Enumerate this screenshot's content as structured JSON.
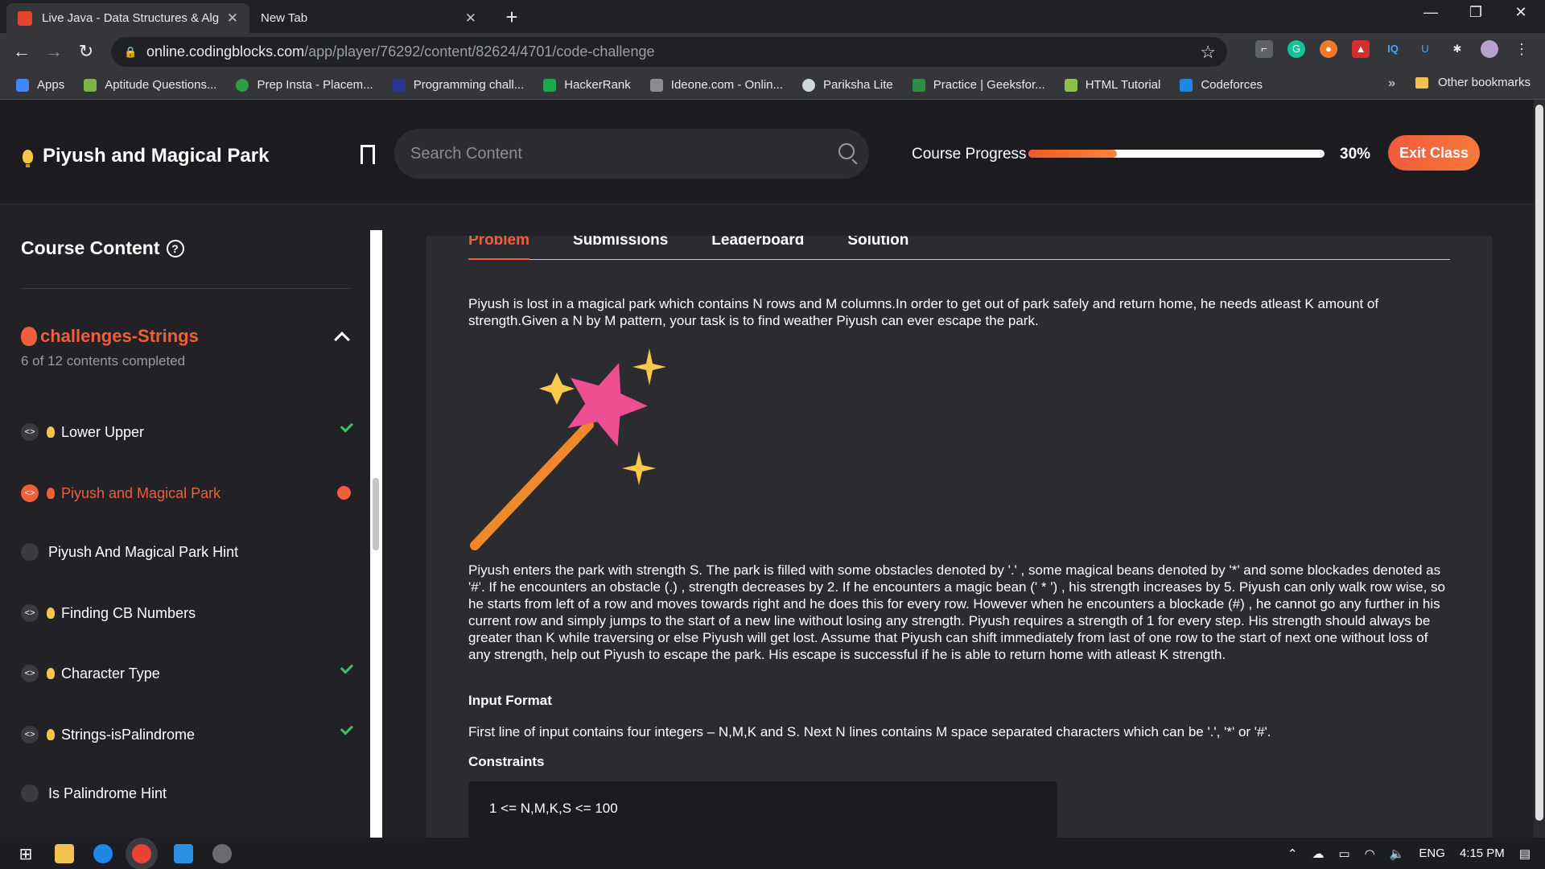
{
  "browser": {
    "tabs": [
      {
        "label": "Live Java - Data Structures & Alg",
        "active": true
      },
      {
        "label": "New Tab",
        "active": false
      }
    ],
    "url_host": "online.codingblocks.com",
    "url_path": "/app/player/76292/content/82624/4701/code-challenge",
    "bookmarks": [
      "Apps",
      "Aptitude Questions...",
      "Prep Insta - Placem...",
      "Programming chall...",
      "HackerRank",
      "Ideone.com - Onlin...",
      "Pariksha Lite",
      "Practice | Geeksfor...",
      "HTML Tutorial",
      "Codeforces"
    ],
    "bookmarks_more": "»",
    "other_bookmarks": "Other bookmarks"
  },
  "header": {
    "title": "Piyush and Magical Park",
    "search_placeholder": "Search Content",
    "progress_label": "Course Progress",
    "progress_value": 0.3,
    "progress_text": "30%",
    "exit_label": "Exit Class"
  },
  "sidebar": {
    "heading": "Course Content",
    "help": "?",
    "section": {
      "title": "challenges-Strings",
      "subtitle": "6 of 12 contents completed"
    },
    "items": [
      {
        "label": "Lower Upper",
        "kind": "code",
        "status": "done"
      },
      {
        "label": "Piyush and Magical Park",
        "kind": "code",
        "status": "active"
      },
      {
        "label": "Piyush And Magical Park Hint",
        "kind": "video",
        "status": ""
      },
      {
        "label": "Finding CB Numbers",
        "kind": "code",
        "status": ""
      },
      {
        "label": "Character Type",
        "kind": "code",
        "status": "done"
      },
      {
        "label": "Strings-isPalindrome",
        "kind": "code",
        "status": "done"
      },
      {
        "label": "Is Palindrome Hint",
        "kind": "video",
        "status": ""
      }
    ]
  },
  "content": {
    "tabs": [
      "Problem",
      "Submissions",
      "Leaderboard",
      "Solution"
    ],
    "intro": "Piyush is lost in a magical park which contains N rows and M columns.In order to get out of park safely and return home, he needs atleast K amount of strength.Given a N by M pattern, your task is to find weather Piyush can ever escape the park.",
    "body": "Piyush enters the park with strength S. The park is filled with some obstacles denoted by '.' , some magical beans denoted by '*' and some blockades denoted as '#'. If he encounters an obstacle (.) , strength decreases by 2. If he encounters a magic bean (' * ') , his strength increases by 5. Piyush can only walk row wise, so he starts from left of a row and moves towards right and he does this for every row. However when he encounters a blockade (#) , he cannot go any further in his current row and simply jumps to the start of a new line without losing any strength. Piyush requires a strength of 1 for every step. His strength should always be greater than K while traversing or else Piyush will get lost. Assume that Piyush can shift immediately from last of one row to the start of next one without loss of any strength, help out Piyush to escape the park. His escape is successful if he is able to return home with atleast K strength.",
    "input_heading": "Input Format",
    "input_text": "First line of input contains four integers – N,M,K and S. Next N lines contains M space separated characters which can be '.', '*' or '#'.",
    "constraints_heading": "Constraints",
    "constraints_text": "1 <= N,M,K,S <= 100"
  },
  "taskbar": {
    "lang": "ENG",
    "time": "4:15 PM"
  },
  "colors": {
    "accent": "#f15e3a",
    "check": "#3ec267",
    "bg": "#212126"
  }
}
